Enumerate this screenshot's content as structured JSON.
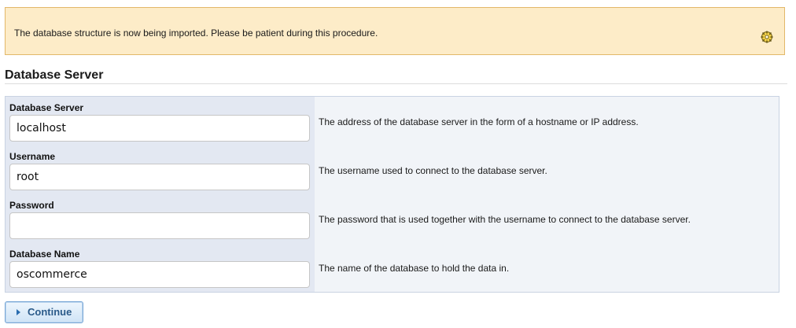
{
  "notice": {
    "message": "The database structure is now being imported. Please be patient during this procedure.",
    "icon": "loading-gear-icon"
  },
  "section": {
    "title": "Database Server"
  },
  "fields": [
    {
      "label": "Database Server",
      "value": "localhost",
      "description": "The address of the database server in the form of a hostname or IP address."
    },
    {
      "label": "Username",
      "value": "root",
      "description": "The username used to connect to the database server."
    },
    {
      "label": "Password",
      "value": "",
      "description": "The password that is used together with the username to connect to the database server."
    },
    {
      "label": "Database Name",
      "value": "oscommerce",
      "description": "The name of the database to hold the data in."
    }
  ],
  "actions": {
    "continue_label": "Continue",
    "continue_icon": "triangle-right-icon"
  },
  "colors": {
    "notice_bg": "#fdecc8",
    "notice_border": "#e2b86a",
    "label_column_bg": "#e3e8f2",
    "button_text": "#2a5a8a"
  }
}
